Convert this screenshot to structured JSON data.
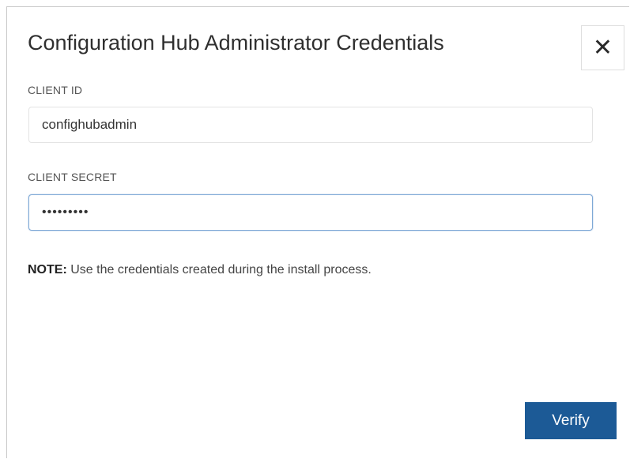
{
  "dialog": {
    "title": "Configuration Hub Administrator Credentials",
    "close_icon": "close-icon",
    "close_glyph": "✕"
  },
  "client_id": {
    "label": "CLIENT ID",
    "value": "confighubadmin"
  },
  "client_secret": {
    "label": "CLIENT SECRET",
    "value": "•••••••••"
  },
  "note": {
    "prefix": "NOTE:",
    "text": " Use the credentials created during the install process."
  },
  "actions": {
    "verify_label": "Verify"
  },
  "colors": {
    "primary_button": "#1c5a96",
    "focused_input_border": "#7fa9d6"
  }
}
